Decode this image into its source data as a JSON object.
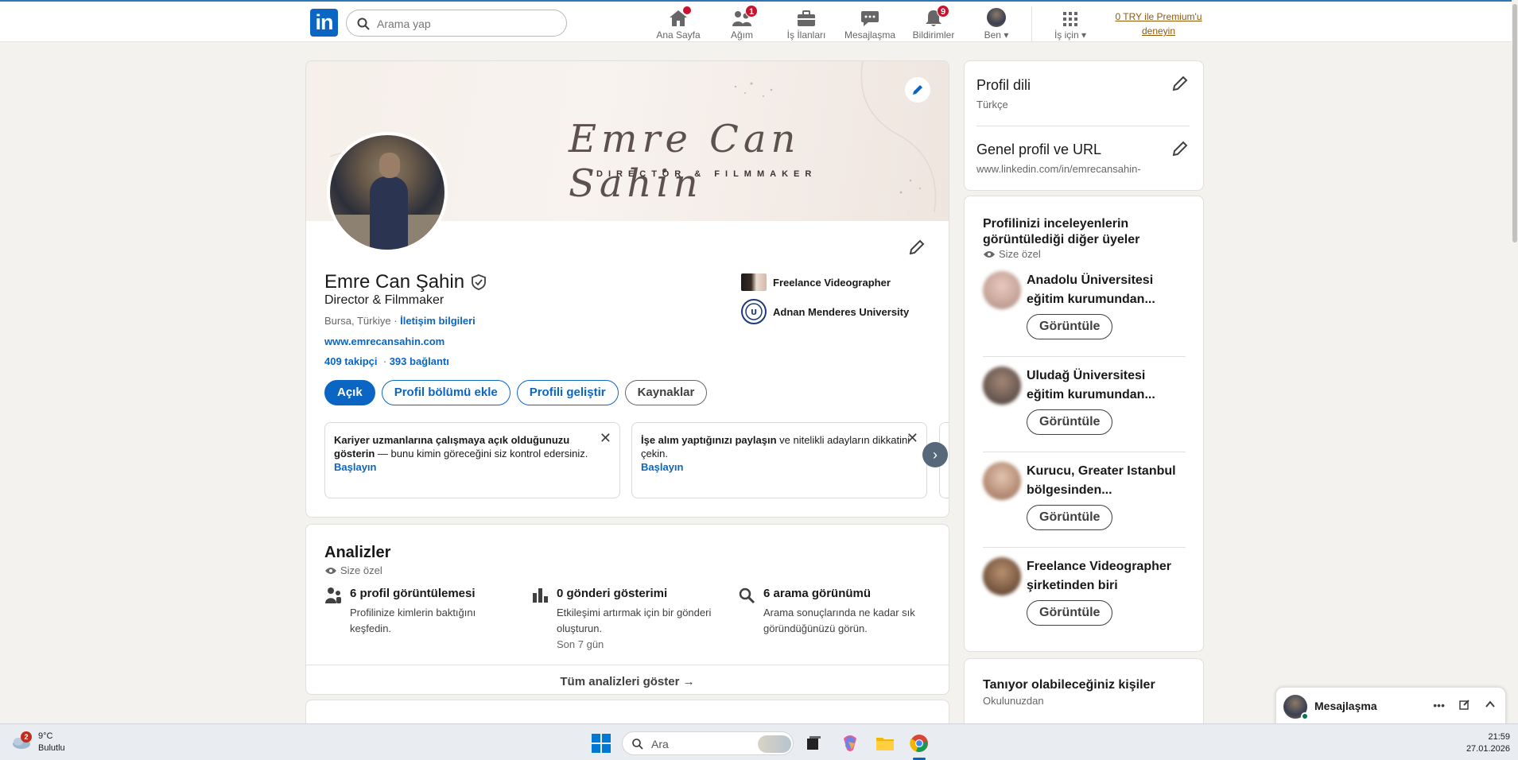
{
  "nav": {
    "search_placeholder": "Arama yap",
    "items": [
      {
        "label": "Ana Sayfa",
        "badge": ""
      },
      {
        "label": "Ağım",
        "badge": "1"
      },
      {
        "label": "İş İlanları",
        "badge": ""
      },
      {
        "label": "Mesajlaşma",
        "badge": ""
      },
      {
        "label": "Bildirimler",
        "badge": "9"
      },
      {
        "label": "Ben",
        "badge": ""
      },
      {
        "label": "İş için",
        "badge": ""
      }
    ],
    "premium_line1": "0 TRY ile Premium'u",
    "premium_line2": "deneyin"
  },
  "profile": {
    "banner_name": "Emre Can Sahin",
    "banner_subtitle": "DIRECTOR & FILMMAKER",
    "name": "Emre Can Şahin",
    "headline": "Director & Filmmaker",
    "location": "Bursa, Türkiye",
    "contact_link": "İletişim bilgileri",
    "website": "www.emrecansahin.com",
    "followers": "409 takipçi",
    "connections": "393 bağlantı",
    "buttons": {
      "open": "Açık",
      "add_section": "Profil bölümü ekle",
      "enhance": "Profili geliştir",
      "resources": "Kaynaklar"
    },
    "experience": [
      {
        "label": "Freelance Videographer"
      },
      {
        "label": "Adnan Menderes University"
      }
    ],
    "promos": [
      {
        "bold": "Kariyer uzmanlarına çalışmaya açık olduğunuzu gösterin",
        "rest": " — bunu kimin göreceğini siz kontrol edersiniz.",
        "cta": "Başlayın"
      },
      {
        "bold": "İşe alım yaptığınızı paylaşın",
        "rest": " ve nitelikli adayların dikkatini çekin.",
        "cta": "Başlayın"
      }
    ]
  },
  "analytics": {
    "title": "Analizler",
    "private": "Size özel",
    "items": [
      {
        "title": "6 profil görüntülemesi",
        "desc": "Profilinize kimlerin baktığını keşfedin.",
        "sub": ""
      },
      {
        "title": "0 gönderi gösterimi",
        "desc": "Etkileşimi artırmak için bir gönderi oluşturun.",
        "sub": "Son 7 gün"
      },
      {
        "title": "6 arama görünümü",
        "desc": "Arama sonuçlarında ne kadar sık göründüğünüzü görün.",
        "sub": ""
      }
    ],
    "footer": "Tüm analizleri göster →"
  },
  "sidebar": {
    "profile_language": {
      "title": "Profil dili",
      "value": "Türkçe"
    },
    "public_profile": {
      "title": "Genel profil ve URL",
      "value": "www.linkedin.com/in/emrecansahin-"
    },
    "viewers": {
      "title": "Profilinizi inceleyenlerin görüntülediği diğer üyeler",
      "private": "Size özel",
      "button": "Görüntüle",
      "items": [
        {
          "name": "Anadolu Üniversitesi eğitim kurumundan...",
          "color": "#c7a59a"
        },
        {
          "name": "Uludağ Üniversitesi eğitim kurumundan...",
          "color": "#6b5a52"
        },
        {
          "name": "Kurucu, Greater Istanbul bölgesinden...",
          "color": "#b78e77"
        },
        {
          "name": "Freelance Videographer şirketinden biri",
          "color": "#7b5a43"
        }
      ]
    },
    "people": {
      "title": "Tanıyor olabileceğiniz kişiler",
      "subtitle": "Okulunuzdan"
    }
  },
  "messaging": {
    "title": "Mesajlaşma"
  },
  "taskbar": {
    "weather_badge": "2",
    "temp": "9°C",
    "condition": "Bulutlu",
    "search_placeholder": "Ara",
    "time": "21:59",
    "date": "27.01.2026"
  },
  "colors": {
    "brand": "#0a66c2",
    "badge": "#cb112d",
    "premium": "#915907"
  }
}
